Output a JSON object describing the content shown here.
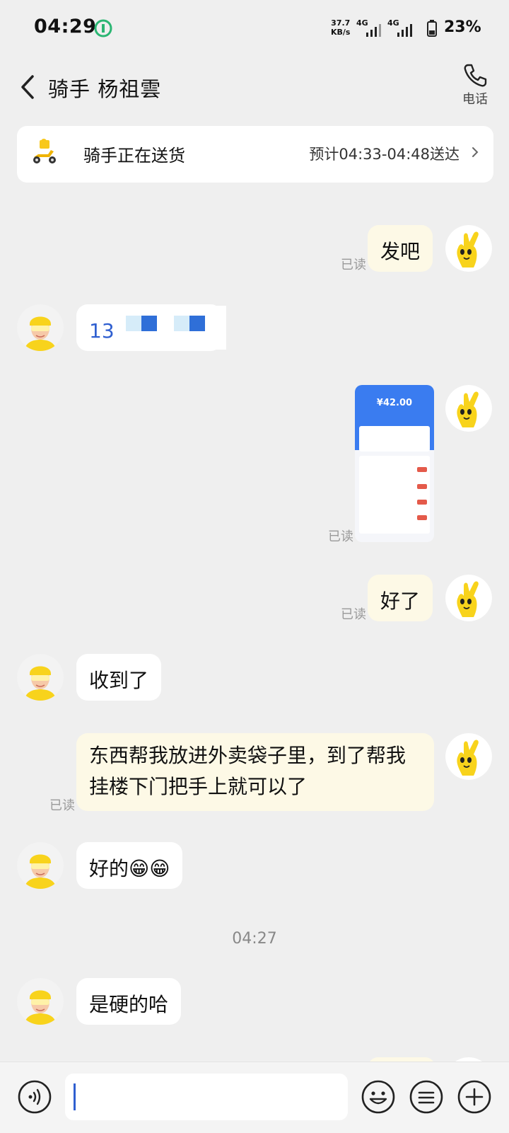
{
  "status_bar": {
    "time": "04:29",
    "net_speed_value": "37.7",
    "net_speed_unit": "KB/s",
    "signal_1": "4G",
    "signal_2": "4G",
    "battery": "23%"
  },
  "header": {
    "title": "骑手 杨祖雲",
    "call_label": "电话"
  },
  "delivery": {
    "status": "骑手正在送货",
    "eta": "预计04:33-04:48送达"
  },
  "messages": {
    "m1": {
      "text": "发吧",
      "read": "已读"
    },
    "m2": {
      "text": "13"
    },
    "m3": {
      "read": "已读",
      "screenshot_amount": "¥42.00"
    },
    "m4": {
      "text": "好了",
      "read": "已读"
    },
    "m5": {
      "text": "收到了"
    },
    "m6": {
      "text": "东西帮我放进外卖袋子里，到了帮我挂楼下门把手上就可以了",
      "read": "已读"
    },
    "m7": {
      "text": "好的😁😁"
    },
    "timestamp": "04:27",
    "m8": {
      "text": "是硬的哈"
    }
  },
  "input": {
    "placeholder": ""
  },
  "colors": {
    "page_bg": "#efefef",
    "my_bubble": "#fdf9e6",
    "rider_bubble": "#ffffff",
    "brand_yellow": "#f8d31c",
    "screenshot_blue": "#3a7cf0"
  },
  "icons": {
    "back": "chevron-left-icon",
    "call": "phone-icon",
    "delivery": "scooter-icon",
    "voice": "voice-icon",
    "emoji": "smile-icon",
    "menu": "list-icon",
    "plus": "plus-icon"
  }
}
